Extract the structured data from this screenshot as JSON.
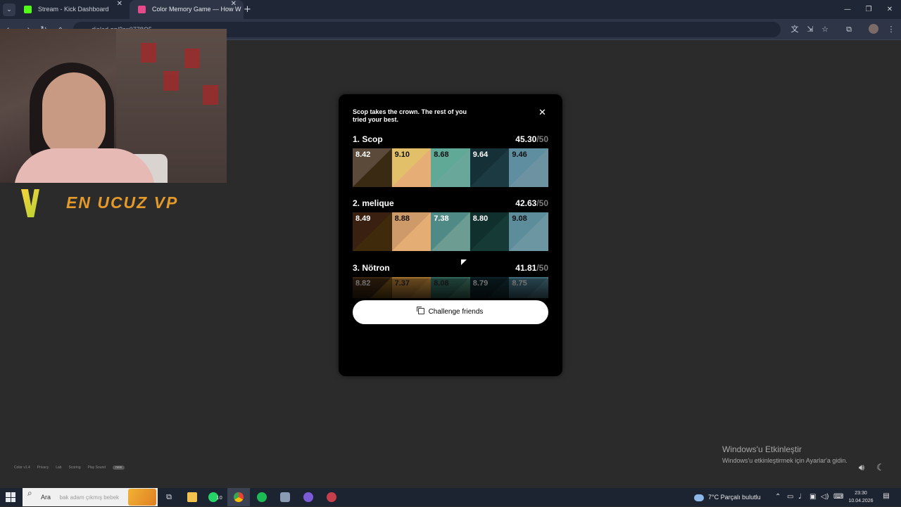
{
  "browser": {
    "tabs": [
      {
        "title": "Stream - Kick Dashboard",
        "favicon_color": "#53fc18",
        "active": false
      },
      {
        "title": "Color Memory Game — How W",
        "favicon_color": "#e64a8a",
        "active": true
      }
    ],
    "url": "dialed.gg/?c=0778O5",
    "tab_list_icon": "chevron-down-icon",
    "new_tab_icon": "plus-icon"
  },
  "overlay": {
    "promo_text": "EN UCUZ VP"
  },
  "modal": {
    "message": "Scop takes the crown. The rest of you tried your best.",
    "close_icon": "close-icon",
    "max_score": "/50",
    "players": [
      {
        "rank_name": "1. Scop",
        "score": "45.30",
        "swatches": [
          {
            "value": "8.42",
            "target": "#5b4a3a",
            "guess": "#3a2a14",
            "text": "#ffffff"
          },
          {
            "value": "9.10",
            "target": "#e2c06a",
            "guess": "#e7ad76",
            "text": "#111111"
          },
          {
            "value": "8.68",
            "target": "#5fa996",
            "guess": "#6aa79b",
            "text": "#111111"
          },
          {
            "value": "9.64",
            "target": "#163038",
            "guess": "#1c3a42",
            "text": "#ffffff"
          },
          {
            "value": "9.46",
            "target": "#5f8ea0",
            "guess": "#6d93a3",
            "text": "#111111"
          }
        ]
      },
      {
        "rank_name": "2. melique",
        "score": "42.63",
        "swatches": [
          {
            "value": "8.49",
            "target": "#3a2010",
            "guess": "#3f2a0c",
            "text": "#ffffff"
          },
          {
            "value": "8.88",
            "target": "#cf9a6a",
            "guess": "#e3ad74",
            "text": "#111111"
          },
          {
            "value": "7.38",
            "target": "#4f8a86",
            "guess": "#6c9c92",
            "text": "#ffffff"
          },
          {
            "value": "8.80",
            "target": "#10302e",
            "guess": "#163a36",
            "text": "#ffffff"
          },
          {
            "value": "9.08",
            "target": "#5d8c9b",
            "guess": "#6d96a3",
            "text": "#111111"
          }
        ]
      },
      {
        "rank_name": "3. Nötron",
        "score": "41.81",
        "swatches": [
          {
            "value": "8.82",
            "target": "#3a2510",
            "guess": "#6a4a12",
            "text": "#c9c9c9"
          },
          {
            "value": "7.37",
            "target": "#a2712f",
            "guess": "#b07d36",
            "text": "#222222"
          },
          {
            "value": "8.08",
            "target": "#2f6457",
            "guess": "#3e7362",
            "text": "#222222"
          },
          {
            "value": "8.79",
            "target": "#0d2228",
            "guess": "#132d34",
            "text": "#c9c9c9"
          },
          {
            "value": "8.75",
            "target": "#3c6878",
            "guess": "#4a7685",
            "text": "#c9c9c9"
          }
        ]
      }
    ],
    "challenge_label": "Challenge friends",
    "challenge_icon": "copy-icon"
  },
  "footer": {
    "links": [
      "Color v1.4",
      "Privacy",
      "Lab",
      "Scoring",
      "Play Sound"
    ],
    "badge": "new"
  },
  "windows_activation": {
    "title": "Windows'u Etkinleştir",
    "subtitle": "Windows'u etkinleştirmek için Ayarlar'a gidin."
  },
  "taskbar": {
    "search_label": "Ara",
    "search_hint": "bak adam çıkmış bebek",
    "whatsapp_badge": "10",
    "weather": "7°C  Parçalı bulutlu",
    "time": "23:30",
    "date": "10.04.2026"
  }
}
